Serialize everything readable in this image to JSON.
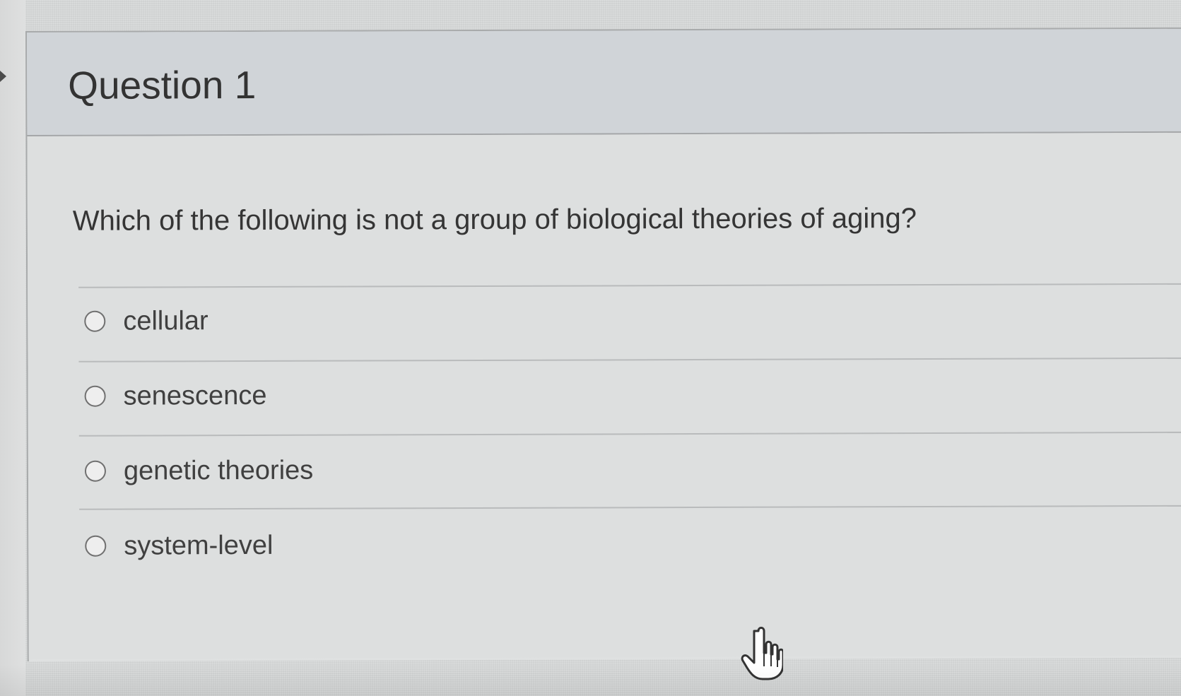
{
  "question": {
    "title": "Question 1",
    "prompt": "Which of the following is not a group of biological theories of aging?",
    "answers": [
      {
        "label": "cellular",
        "selected": false
      },
      {
        "label": "senescence",
        "selected": false
      },
      {
        "label": "genetic theories",
        "selected": false
      },
      {
        "label": "system-level",
        "selected": false
      }
    ]
  },
  "icons": {
    "collapse_marker": "triangle-right-icon",
    "cursor": "hand-pointer-icon"
  }
}
